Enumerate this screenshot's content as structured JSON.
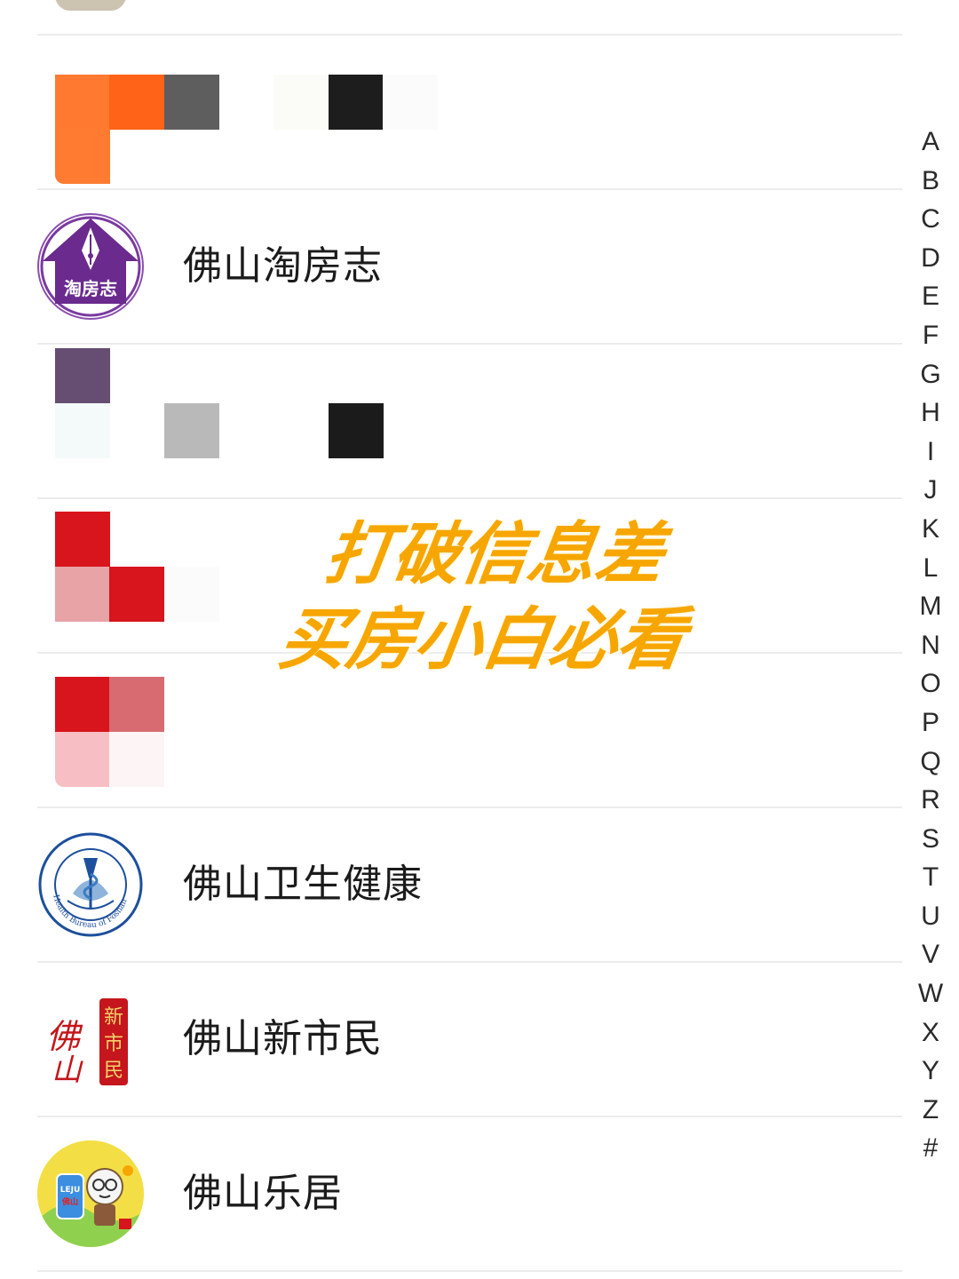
{
  "contacts": [
    {
      "name": "佛山淘房志",
      "avatar_icon": "taofangzhi-logo-icon",
      "logo_text": "淘房志"
    },
    {
      "name": "佛山卫生健康",
      "avatar_icon": "health-bureau-seal-icon",
      "logo_text": "Health Bureau of Foshan"
    },
    {
      "name": "佛山新市民",
      "avatar_icon": "xinshimin-calligraphy-icon",
      "logo_text": "佛山新市民"
    },
    {
      "name": "佛山乐居",
      "avatar_icon": "leju-mascot-icon",
      "logo_text": "LEJU 佛山"
    }
  ],
  "overlay": {
    "line1": "打破信息差",
    "line2": "买房小白必看"
  },
  "index_letters": [
    "A",
    "B",
    "C",
    "D",
    "E",
    "F",
    "G",
    "H",
    "I",
    "J",
    "K",
    "L",
    "M",
    "N",
    "O",
    "P",
    "Q",
    "R",
    "S",
    "T",
    "U",
    "V",
    "W",
    "X",
    "Y",
    "Z",
    "#"
  ],
  "colors": {
    "overlay_text": "#f7a600",
    "taofangzhi_purple": "#6a2a8e",
    "health_blue": "#1d4f9c",
    "xinshimin_red": "#c4161c"
  }
}
